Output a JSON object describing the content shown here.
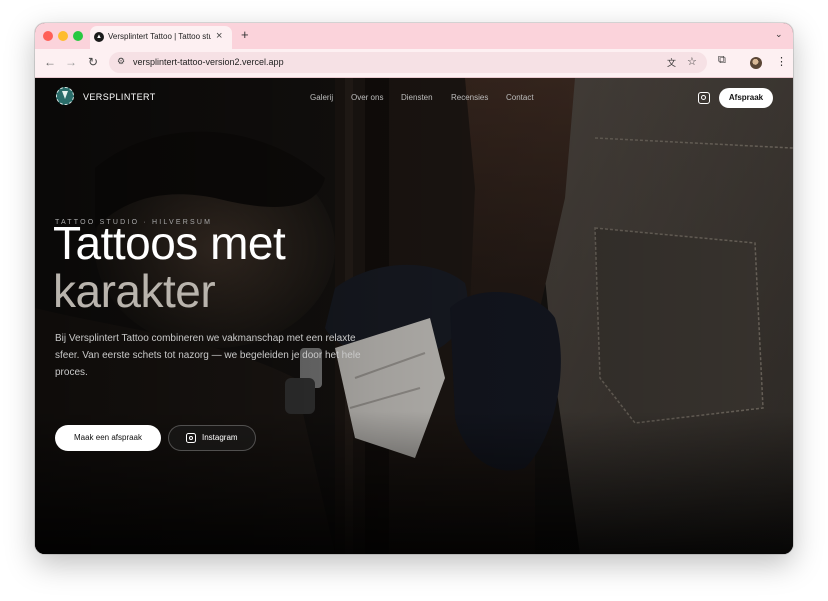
{
  "browser": {
    "tab": {
      "title": "Versplintert Tattoo | Tattoo studio",
      "favicon": "triangle-icon"
    },
    "url": "versplintert-tattoo-version2.vercel.app",
    "icons": [
      "back-icon",
      "forward-icon",
      "reload-icon",
      "site-info-icon",
      "translate-icon",
      "star-icon",
      "extensions-icon",
      "kebab-icon"
    ]
  },
  "site": {
    "logo_text": "VERSPLINTERT",
    "nav": [
      "Galerij",
      "Over ons",
      "Diensten",
      "Recensies",
      "Contact"
    ],
    "cta_label": "Afspraak"
  },
  "hero": {
    "eyebrow": "TATTOO STUDIO · HILVERSUM",
    "title_line1": "Tattoos met",
    "title_line2": "karakter",
    "lead": "Bij Versplintert Tattoo combineren we vakmanschap met een relaxte sfeer. Van eerste schets tot nazorg — we begeleiden je door het hele proces.",
    "primary_button": "Maak een afspraak",
    "secondary_button": "Instagram"
  }
}
